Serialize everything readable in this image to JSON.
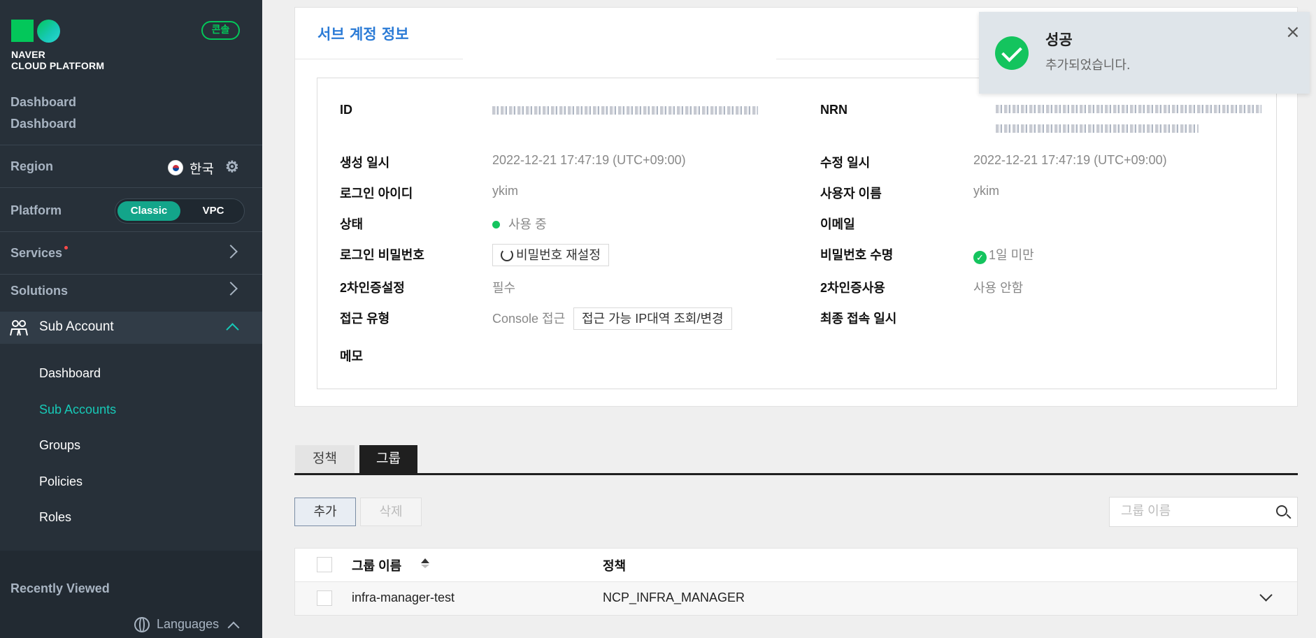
{
  "sidebar": {
    "logo_line1": "NAVER",
    "logo_line2": "CLOUD PLATFORM",
    "console_badge": "콘솔",
    "dashboard": "Dashboard",
    "region_label": "Region",
    "region_value": "한국",
    "platform_label": "Platform",
    "platform_classic": "Classic",
    "platform_vpc": "VPC",
    "services": "Services",
    "solutions": "Solutions",
    "sub_account": "Sub Account",
    "sub_items": [
      "Dashboard",
      "Sub Accounts",
      "Groups",
      "Policies",
      "Roles"
    ],
    "recently_viewed": "Recently Viewed",
    "languages": "Languages"
  },
  "panel": {
    "title": "서브 계정 정보",
    "left": {
      "id_label": "ID",
      "created_label": "생성 일시",
      "created_value": "2022-12-21 17:47:19 (UTC+09:00)",
      "login_id_label": "로그인 아이디",
      "login_id_value": "ykim",
      "status_label": "상태",
      "status_value": "사용 중",
      "password_label": "로그인 비밀번호",
      "password_button": "비밀번호 재설정",
      "twofa_label": "2차인증설정",
      "twofa_value": "필수",
      "access_label": "접근 유형",
      "access_value": "Console 접근",
      "access_button": "접근 가능 IP대역 조회/변경",
      "memo_label": "메모"
    },
    "right": {
      "nrn_label": "NRN",
      "modified_label": "수정 일시",
      "modified_value": "2022-12-21 17:47:19 (UTC+09:00)",
      "username_label": "사용자 이름",
      "username_value": "ykim",
      "email_label": "이메일",
      "pw_life_label": "비밀번호 수명",
      "pw_life_value": "1일 미만",
      "twofa_use_label": "2차인증사용",
      "twofa_use_value": "사용 안함",
      "last_login_label": "최종 접속 일시"
    }
  },
  "tabs": [
    "정책",
    "그룹"
  ],
  "actions": {
    "add": "추가",
    "delete": "삭제"
  },
  "search": {
    "placeholder": "그룹 이름"
  },
  "table": {
    "headers": [
      "그룹 이름",
      "정책"
    ],
    "rows": [
      {
        "group": "infra-manager-test",
        "policy": "NCP_INFRA_MANAGER"
      }
    ]
  },
  "toast": {
    "title": "성공",
    "message": "추가되었습니다.",
    "close": "×"
  }
}
